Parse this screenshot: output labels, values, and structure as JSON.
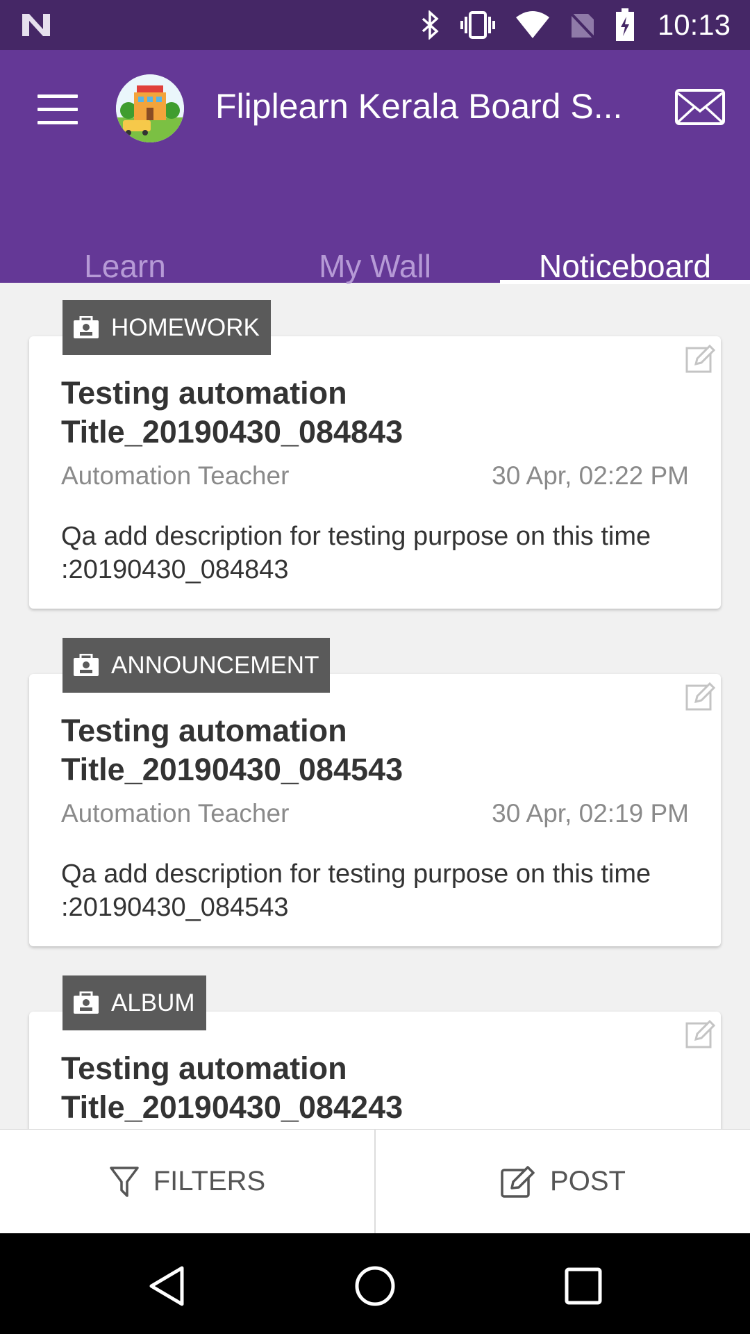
{
  "status_bar": {
    "time": "10:13",
    "icons": [
      "notification-n-icon",
      "bluetooth-icon",
      "vibrate-icon",
      "wifi-icon",
      "no-sim-icon",
      "battery-charging-icon"
    ]
  },
  "app_bar": {
    "title": "Fliplearn Kerala Board S...",
    "menu_icon": "hamburger-menu-icon",
    "avatar_icon": "school-logo",
    "mail_icon": "mail-icon"
  },
  "tabs": [
    {
      "label": "Learn",
      "active": false
    },
    {
      "label": "My Wall",
      "active": false
    },
    {
      "label": "Noticeboard",
      "active": true
    }
  ],
  "posts": [
    {
      "category": "HOMEWORK",
      "title": "Testing automation Title_20190430_084843",
      "author": "Automation Teacher",
      "date": "30 Apr, 02:22 PM",
      "description": "Qa add description for testing purpose on this time :20190430_084843"
    },
    {
      "category": "ANNOUNCEMENT",
      "title": "Testing automation Title_20190430_084543",
      "author": "Automation Teacher",
      "date": "30 Apr, 02:19 PM",
      "description": "Qa add description for testing purpose on this time :20190430_084543"
    },
    {
      "category": "ALBUM",
      "title": "Testing automation Title_20190430_084243",
      "author": "",
      "date": "",
      "description": ""
    }
  ],
  "bottom_bar": {
    "filters_label": "FILTERS",
    "post_label": "POST"
  },
  "colors": {
    "status_bar": "#452766",
    "app_bar": "#643896",
    "badge": "#5a5a5a",
    "background": "#f1f1f1"
  }
}
